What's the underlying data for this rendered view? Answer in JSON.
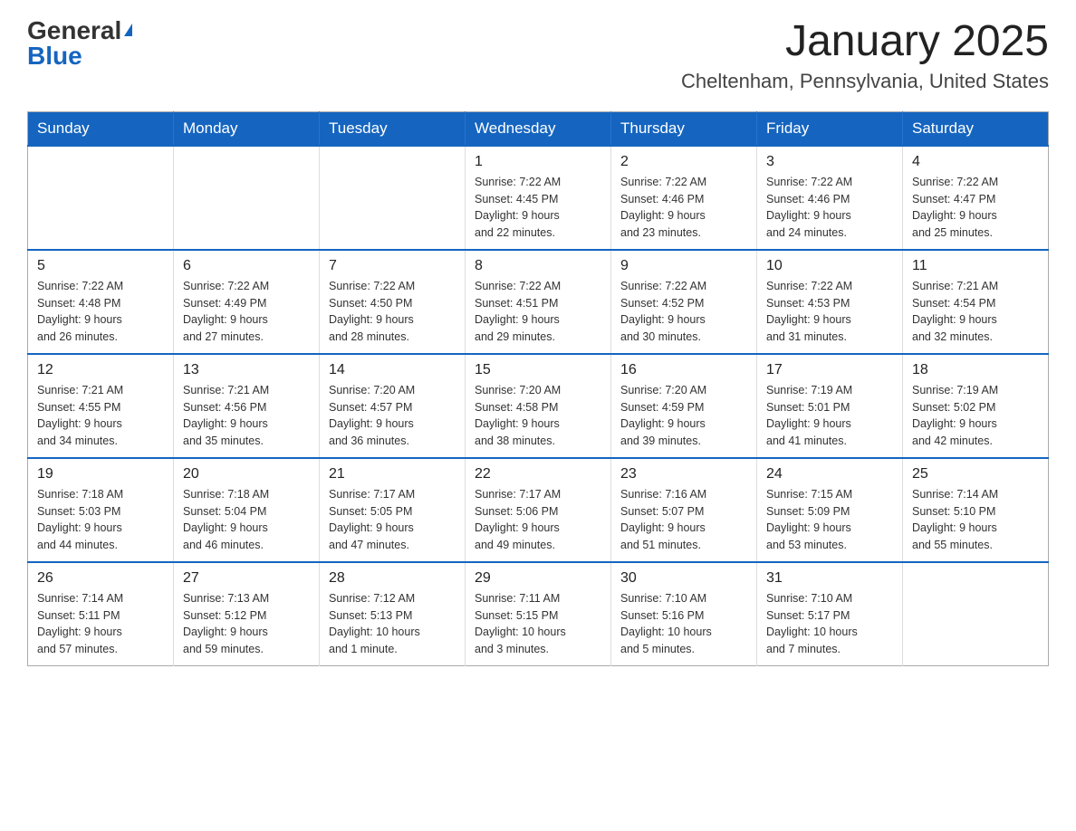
{
  "logo": {
    "general": "General",
    "triangle": "▶",
    "blue": "Blue"
  },
  "title": "January 2025",
  "location": "Cheltenham, Pennsylvania, United States",
  "days_of_week": [
    "Sunday",
    "Monday",
    "Tuesday",
    "Wednesday",
    "Thursday",
    "Friday",
    "Saturday"
  ],
  "weeks": [
    [
      {
        "day": "",
        "info": ""
      },
      {
        "day": "",
        "info": ""
      },
      {
        "day": "",
        "info": ""
      },
      {
        "day": "1",
        "info": "Sunrise: 7:22 AM\nSunset: 4:45 PM\nDaylight: 9 hours\nand 22 minutes."
      },
      {
        "day": "2",
        "info": "Sunrise: 7:22 AM\nSunset: 4:46 PM\nDaylight: 9 hours\nand 23 minutes."
      },
      {
        "day": "3",
        "info": "Sunrise: 7:22 AM\nSunset: 4:46 PM\nDaylight: 9 hours\nand 24 minutes."
      },
      {
        "day": "4",
        "info": "Sunrise: 7:22 AM\nSunset: 4:47 PM\nDaylight: 9 hours\nand 25 minutes."
      }
    ],
    [
      {
        "day": "5",
        "info": "Sunrise: 7:22 AM\nSunset: 4:48 PM\nDaylight: 9 hours\nand 26 minutes."
      },
      {
        "day": "6",
        "info": "Sunrise: 7:22 AM\nSunset: 4:49 PM\nDaylight: 9 hours\nand 27 minutes."
      },
      {
        "day": "7",
        "info": "Sunrise: 7:22 AM\nSunset: 4:50 PM\nDaylight: 9 hours\nand 28 minutes."
      },
      {
        "day": "8",
        "info": "Sunrise: 7:22 AM\nSunset: 4:51 PM\nDaylight: 9 hours\nand 29 minutes."
      },
      {
        "day": "9",
        "info": "Sunrise: 7:22 AM\nSunset: 4:52 PM\nDaylight: 9 hours\nand 30 minutes."
      },
      {
        "day": "10",
        "info": "Sunrise: 7:22 AM\nSunset: 4:53 PM\nDaylight: 9 hours\nand 31 minutes."
      },
      {
        "day": "11",
        "info": "Sunrise: 7:21 AM\nSunset: 4:54 PM\nDaylight: 9 hours\nand 32 minutes."
      }
    ],
    [
      {
        "day": "12",
        "info": "Sunrise: 7:21 AM\nSunset: 4:55 PM\nDaylight: 9 hours\nand 34 minutes."
      },
      {
        "day": "13",
        "info": "Sunrise: 7:21 AM\nSunset: 4:56 PM\nDaylight: 9 hours\nand 35 minutes."
      },
      {
        "day": "14",
        "info": "Sunrise: 7:20 AM\nSunset: 4:57 PM\nDaylight: 9 hours\nand 36 minutes."
      },
      {
        "day": "15",
        "info": "Sunrise: 7:20 AM\nSunset: 4:58 PM\nDaylight: 9 hours\nand 38 minutes."
      },
      {
        "day": "16",
        "info": "Sunrise: 7:20 AM\nSunset: 4:59 PM\nDaylight: 9 hours\nand 39 minutes."
      },
      {
        "day": "17",
        "info": "Sunrise: 7:19 AM\nSunset: 5:01 PM\nDaylight: 9 hours\nand 41 minutes."
      },
      {
        "day": "18",
        "info": "Sunrise: 7:19 AM\nSunset: 5:02 PM\nDaylight: 9 hours\nand 42 minutes."
      }
    ],
    [
      {
        "day": "19",
        "info": "Sunrise: 7:18 AM\nSunset: 5:03 PM\nDaylight: 9 hours\nand 44 minutes."
      },
      {
        "day": "20",
        "info": "Sunrise: 7:18 AM\nSunset: 5:04 PM\nDaylight: 9 hours\nand 46 minutes."
      },
      {
        "day": "21",
        "info": "Sunrise: 7:17 AM\nSunset: 5:05 PM\nDaylight: 9 hours\nand 47 minutes."
      },
      {
        "day": "22",
        "info": "Sunrise: 7:17 AM\nSunset: 5:06 PM\nDaylight: 9 hours\nand 49 minutes."
      },
      {
        "day": "23",
        "info": "Sunrise: 7:16 AM\nSunset: 5:07 PM\nDaylight: 9 hours\nand 51 minutes."
      },
      {
        "day": "24",
        "info": "Sunrise: 7:15 AM\nSunset: 5:09 PM\nDaylight: 9 hours\nand 53 minutes."
      },
      {
        "day": "25",
        "info": "Sunrise: 7:14 AM\nSunset: 5:10 PM\nDaylight: 9 hours\nand 55 minutes."
      }
    ],
    [
      {
        "day": "26",
        "info": "Sunrise: 7:14 AM\nSunset: 5:11 PM\nDaylight: 9 hours\nand 57 minutes."
      },
      {
        "day": "27",
        "info": "Sunrise: 7:13 AM\nSunset: 5:12 PM\nDaylight: 9 hours\nand 59 minutes."
      },
      {
        "day": "28",
        "info": "Sunrise: 7:12 AM\nSunset: 5:13 PM\nDaylight: 10 hours\nand 1 minute."
      },
      {
        "day": "29",
        "info": "Sunrise: 7:11 AM\nSunset: 5:15 PM\nDaylight: 10 hours\nand 3 minutes."
      },
      {
        "day": "30",
        "info": "Sunrise: 7:10 AM\nSunset: 5:16 PM\nDaylight: 10 hours\nand 5 minutes."
      },
      {
        "day": "31",
        "info": "Sunrise: 7:10 AM\nSunset: 5:17 PM\nDaylight: 10 hours\nand 7 minutes."
      },
      {
        "day": "",
        "info": ""
      }
    ]
  ]
}
